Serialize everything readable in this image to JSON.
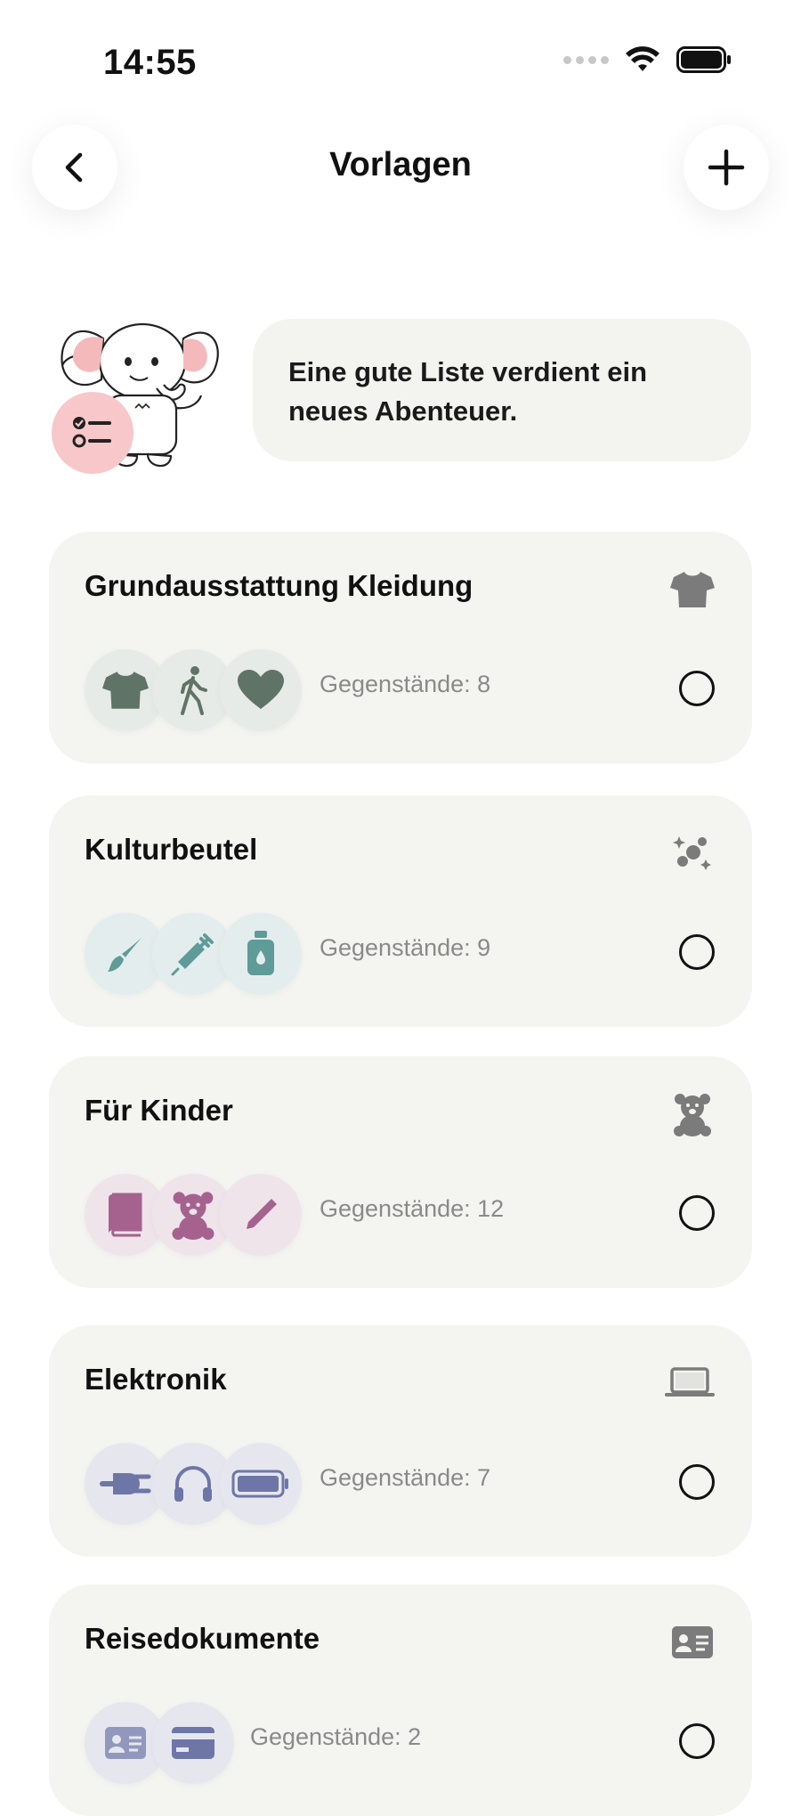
{
  "status": {
    "time": "14:55"
  },
  "header": {
    "title": "Vorlagen",
    "back_icon": "chevron-left-icon",
    "add_icon": "plus-icon"
  },
  "banner": {
    "message": "Eine gute Liste verdient ein neues Abenteuer."
  },
  "templates": [
    {
      "title": "Grundausstattung Kleidung",
      "count": "Gegenstände: 8",
      "icon": "tshirt-icon",
      "item_icons": [
        "tshirt-icon",
        "walking-person-icon",
        "heart-icon"
      ],
      "color": "#5f7466",
      "bg": "#e6ebe7"
    },
    {
      "title": "Kulturbeutel",
      "count": "Gegenstände: 9",
      "icon": "sparkles-icon",
      "item_icons": [
        "brush-icon",
        "syringe-icon",
        "bottle-icon"
      ],
      "color": "#5f9b98",
      "bg": "#e3eded"
    },
    {
      "title": "Für Kinder",
      "count": "Gegenstände: 12",
      "icon": "teddy-bear-icon",
      "item_icons": [
        "book-icon",
        "teddy-bear-icon",
        "pencil-icon"
      ],
      "color": "#a6628f",
      "bg": "#efe4ea"
    },
    {
      "title": "Elektronik",
      "count": "Gegenstände: 7",
      "icon": "laptop-icon",
      "item_icons": [
        "plug-icon",
        "headphones-icon",
        "battery-icon"
      ],
      "color": "#6e76a8",
      "bg": "#e6e7ee"
    },
    {
      "title": "Reisedokumente",
      "count": "Gegenstände: 2",
      "icon": "id-card-icon",
      "item_icons": [
        "id-card-icon",
        "credit-card-icon"
      ],
      "color": "#6e76a8",
      "bg": "#e6e7ee"
    }
  ]
}
